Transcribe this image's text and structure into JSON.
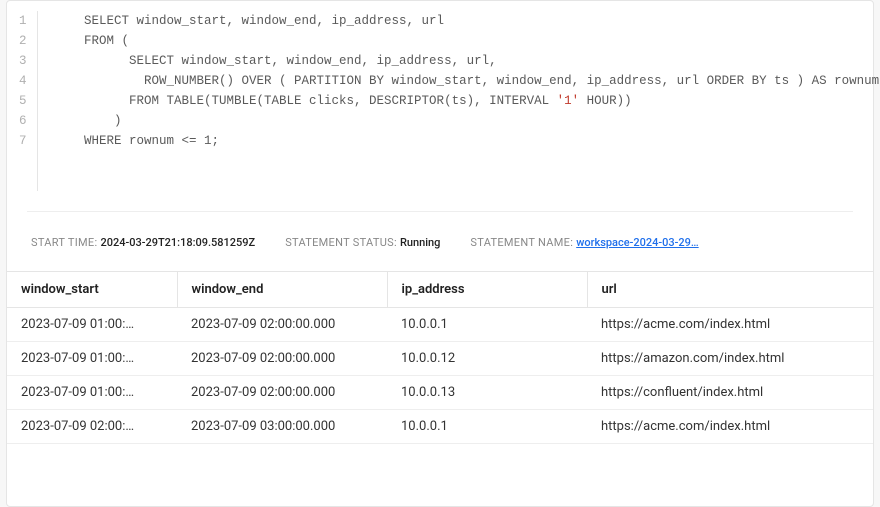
{
  "code": {
    "lines": [
      "1",
      "2",
      "3",
      "4",
      "5",
      "6",
      "7"
    ],
    "l1": "    SELECT window_start, window_end, ip_address, url",
    "l2": "    FROM (",
    "l3": "          SELECT window_start, window_end, ip_address, url,",
    "l4a": "            ROW_NUMBER() OVER ( PARTITION BY window_start, window_end, ip_address, url ORDER BY ts ) AS rownum",
    "l5a": "          FROM TABLE(TUMBLE(TABLE clicks, DESCRIPTOR(ts), INTERVAL ",
    "l5b": "'1'",
    "l5c": " HOUR))",
    "l6": "        )",
    "l7": "    WHERE rownum <= 1;"
  },
  "status": {
    "start_time_label": "Start time: ",
    "start_time_value": "2024-03-29T21:18:09.581259Z",
    "status_label": "Statement status: ",
    "status_value": "Running",
    "name_label": "Statement name: ",
    "name_value": "workspace-2024-03-29…"
  },
  "table": {
    "headers": {
      "c1": "window_start",
      "c2": "window_end",
      "c3": "ip_address",
      "c4": "url"
    },
    "rows": [
      {
        "c1": "2023-07-09 01:00:…",
        "c2": "2023-07-09 02:00:00.000",
        "c3": "10.0.0.1",
        "c4": "https://acme.com/index.html"
      },
      {
        "c1": "2023-07-09 01:00:…",
        "c2": "2023-07-09 02:00:00.000",
        "c3": "10.0.0.12",
        "c4": "https://amazon.com/index.html"
      },
      {
        "c1": "2023-07-09 01:00:…",
        "c2": "2023-07-09 02:00:00.000",
        "c3": "10.0.0.13",
        "c4": "https://confluent/index.html"
      },
      {
        "c1": "2023-07-09 02:00:…",
        "c2": "2023-07-09 03:00:00.000",
        "c3": "10.0.0.1",
        "c4": "https://acme.com/index.html"
      }
    ]
  }
}
